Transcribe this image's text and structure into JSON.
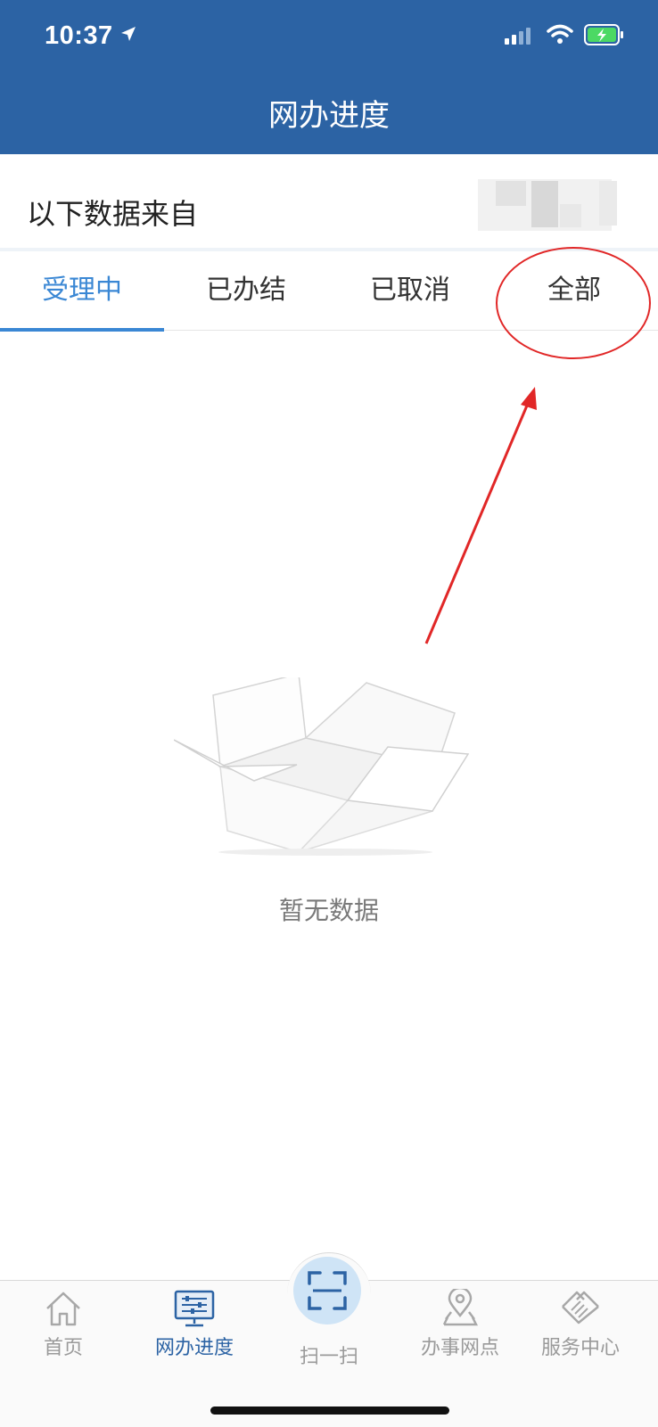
{
  "status_bar": {
    "time": "10:37"
  },
  "header": {
    "title": "网办进度"
  },
  "source": {
    "label": "以下数据来自"
  },
  "tabs": [
    {
      "label": "受理中",
      "active": true
    },
    {
      "label": "已办结",
      "active": false
    },
    {
      "label": "已取消",
      "active": false
    },
    {
      "label": "全部",
      "active": false
    }
  ],
  "empty_state": {
    "message": "暂无数据"
  },
  "bottom_nav": {
    "items": [
      {
        "label": "首页",
        "icon": "home-icon"
      },
      {
        "label": "网办进度",
        "icon": "monitor-icon",
        "active": true
      },
      {
        "label": "扫一扫",
        "icon": "scan-icon"
      },
      {
        "label": "办事网点",
        "icon": "location-pin-icon"
      },
      {
        "label": "服务中心",
        "icon": "handshake-icon"
      }
    ]
  },
  "colors": {
    "primary": "#2c63a4",
    "tab_active": "#3a87d4",
    "annotation": "#e12727"
  }
}
